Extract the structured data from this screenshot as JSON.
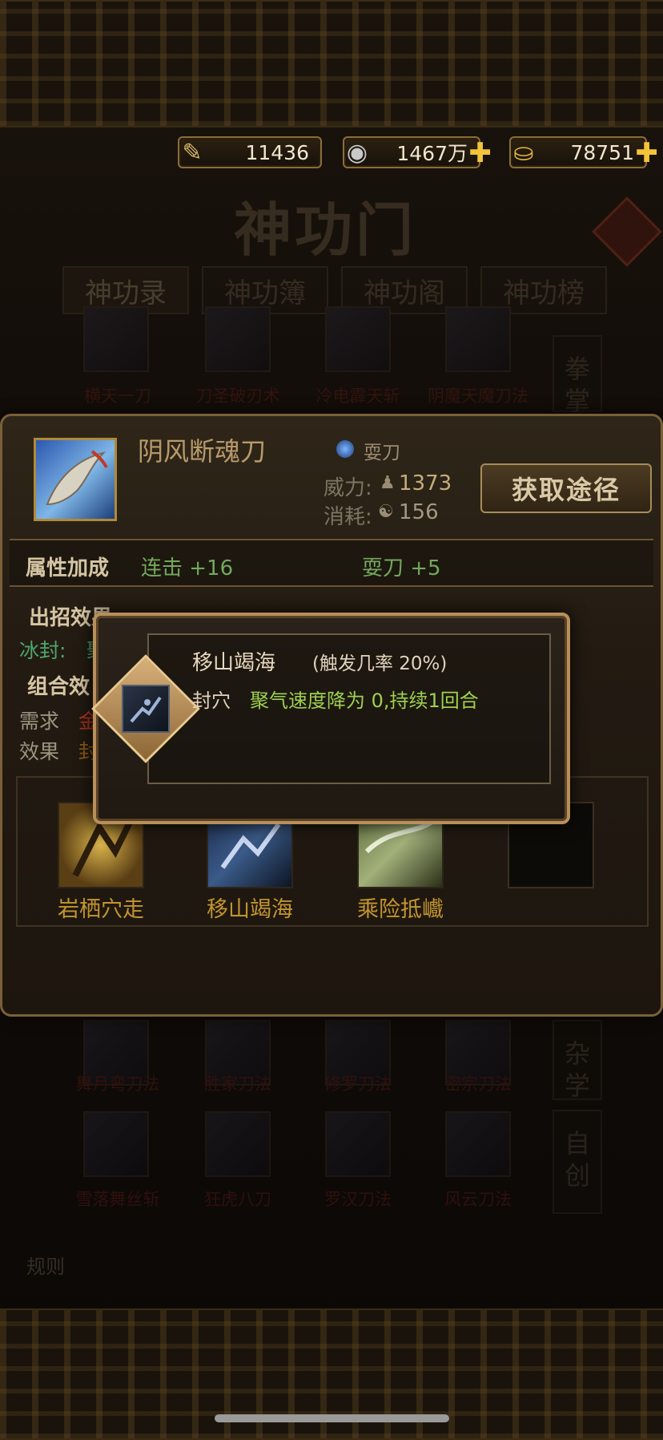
{
  "currency": {
    "scroll_value": "11436",
    "silver_value": "1467万",
    "gold_value": "78751"
  },
  "header": {
    "title": "神功门",
    "tabs": [
      {
        "label": "神功录"
      },
      {
        "label": "神功簿"
      },
      {
        "label": "神功阁"
      },
      {
        "label": "神功榜"
      }
    ]
  },
  "background_list": {
    "row1": [
      "横天一刀",
      "刀圣破刃术",
      "冷电霹天斩",
      "阴魔天魔刀法"
    ],
    "row2": [
      "舞月弯刀法",
      "胜家刀法",
      "修罗刀法",
      "密宗刀法"
    ],
    "row3": [
      "雪落舞丝斩",
      "狂虎八刀",
      "罗汉刀法",
      "风云刀法"
    ],
    "side_tabs": [
      "拳掌",
      "杂学",
      "自创"
    ]
  },
  "skill": {
    "name": "阴风断魂刀",
    "type": "耍刀",
    "power_label": "威力:",
    "power_value": "1373",
    "cost_label": "消耗:",
    "cost_value": "156",
    "get_button": "获取途径"
  },
  "attributes": {
    "title": "属性加成",
    "bonus1": "连击 +16",
    "bonus2": "耍刀 +5"
  },
  "move_effect": {
    "title": "出招效果",
    "freeze_label": "冰封:",
    "freeze_text": "聚气"
  },
  "combo": {
    "title": "组合效",
    "require_label": "需求",
    "require_text": "金",
    "effect_label": "效果",
    "effect_text": "封",
    "slots": [
      "岩栖穴走",
      "移山竭海",
      "乘险抵巇"
    ]
  },
  "popup": {
    "name": "移山竭海",
    "chance": "(触发几率 20%)",
    "effect_label": "封穴",
    "effect_text": "聚气速度降为 0,持续1回合"
  },
  "bottom": {
    "rules_label": "规则"
  }
}
